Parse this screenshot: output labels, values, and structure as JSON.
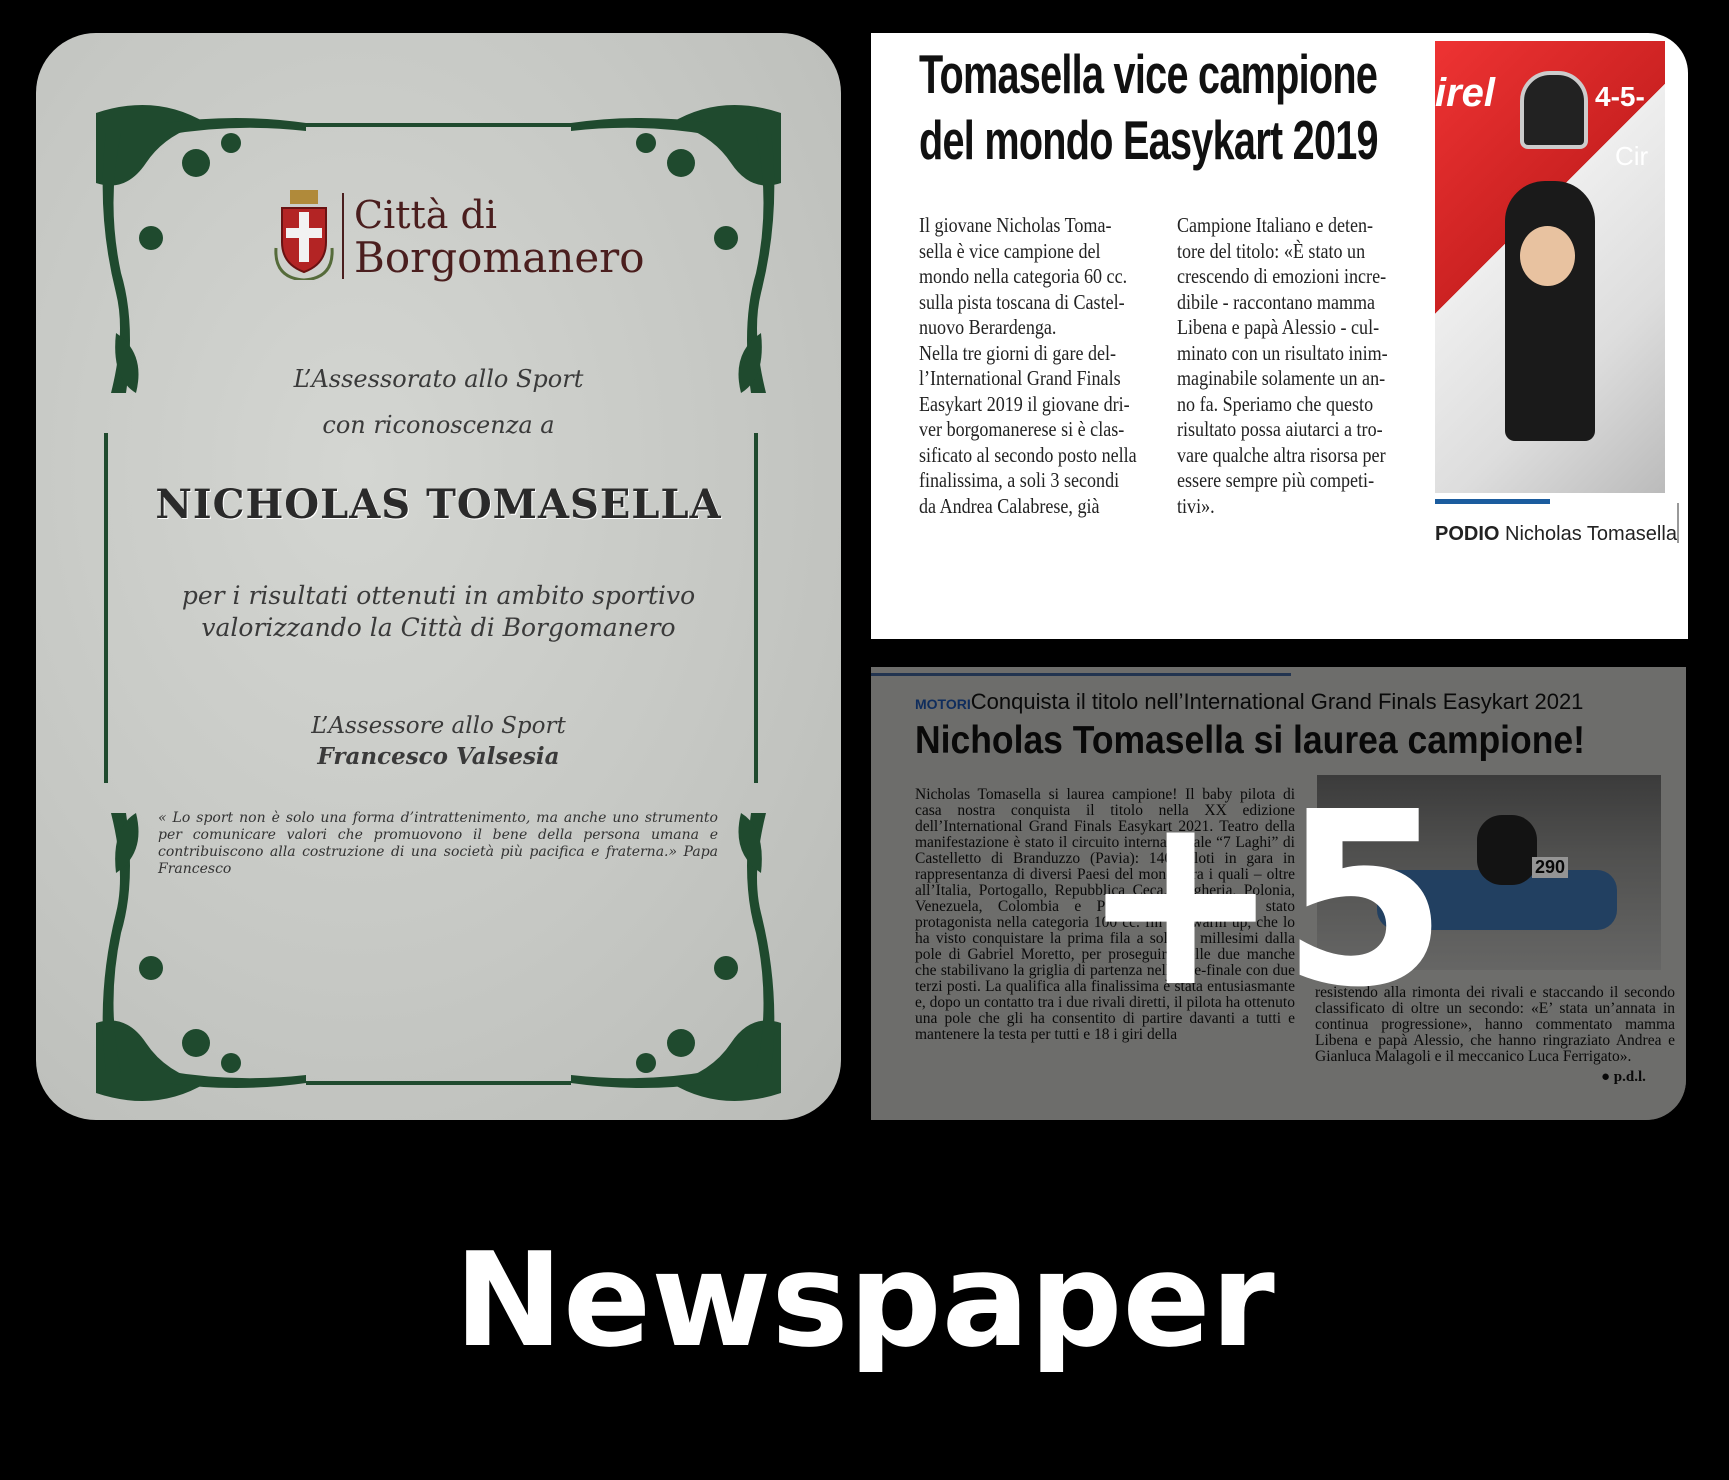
{
  "certificate": {
    "city_line1": "Città di",
    "city_line2": "Borgomanero",
    "line1": "L’Assessorato allo Sport",
    "line2": "con riconoscenza a",
    "recipient": "NICHOLAS TOMASELLA",
    "motivation1": "per i risultati ottenuti in ambito sportivo",
    "motivation2": "valorizzando la Città di Borgomanero",
    "signer_role": "L’Assessore allo Sport",
    "signer_name": "Francesco Valsesia",
    "quote": "« Lo sport non è solo una forma d’intrattenimento, ma anche uno strumento per comunicare valori che promuovono il bene della persona umana e contribuiscono alla costruzione di una società più pacifica e fraterna.» Papa Francesco",
    "frame_color": "#1f4a2e"
  },
  "article1": {
    "headline_line1": "Tomasella vice campione",
    "headline_line2": "del mondo Easykart 2019",
    "col1": [
      "Il giovane Nicholas Toma-",
      "sella è vice campione del",
      "mondo nella categoria 60 cc.",
      "sulla pista toscana di Castel-",
      "nuovo Berardenga.",
      "Nella tre giorni di gare del-",
      "l’International Grand Finals",
      "Easykart 2019 il giovane dri-",
      "ver borgomanerese si è clas-",
      "sificato al secondo posto nella",
      "finalissima, a soli 3 secondi",
      "da Andrea Calabrese, già"
    ],
    "col2": [
      "Campione Italiano e deten-",
      "tore del titolo: «È stato un",
      "crescendo di emozioni incre-",
      "dibile - raccontano mamma",
      "Libena e papà Alessio - cul-",
      "minato con un risultato inim-",
      "maginabile solamente un an-",
      "no fa. Speriamo che questo",
      "risultato possa aiutarci a tro-",
      "vare qualche altra risorsa per",
      "essere sempre più competi-",
      "tivi»."
    ],
    "photo_text1": "4-5-",
    "photo_text2": "Cir",
    "photo_text3": "irel",
    "caption_bold": "PODIO",
    "caption_rest": " Nicholas Tomasella",
    "accent_color": "#1b5c9e"
  },
  "article2": {
    "section": "MOTORI",
    "kicker": "Conquista il titolo nell’International Grand Finals Easykart 2021",
    "headline": "Nicholas Tomasella si laurea campione!",
    "body_left": "Nicholas Tomasella si laurea campione! Il baby pilota di casa nostra conquista il titolo nella XX edizione dell’International Grand Finals Easykart 2021. Teatro della manifestazione è stato il circuito internazionale “7 Laghi” di Castelletto di Branduzzo (Pavia): 140 piloti in gara in rappresentanza di diversi Paesi del mondo fra i quali – oltre all’Italia, Portogallo, Repubblica Ceca, Ungheria, Polonia, Venezuela, Colombia e Panama. Tomasella è stato protagonista nella categoria 100 cc. fin dal warm up, che lo ha visto conquistare la prima fila a soli 83 millesimi dalla pole di Gabriel Moretto, per proseguire nelle due manche che stabilivano la griglia di partenza nella pre-finale con due terzi posti. La qualifica alla finalissima è stata entusiasmante e, dopo un contatto tra i due rivali diretti, il pilota ha ottenuto una pole che gli ha consentito di partire davanti a tutti e mantenere la testa per tutti e 18 i giri della",
    "body_right": "resistendo alla rimonta dei rivali e staccando il secondo classificato di oltre un secondo: «E’ stata un’annata in continua progressione», hanno commentato mamma Libena e papà Alessio, che hanno ringraziato Andrea e Gianluca Malagoli e il meccanico Luca Ferrigato».",
    "kart_number": "290",
    "signature": "● p.d.l.",
    "overlay_count": "+5"
  },
  "footer": {
    "label": "Newspaper"
  }
}
